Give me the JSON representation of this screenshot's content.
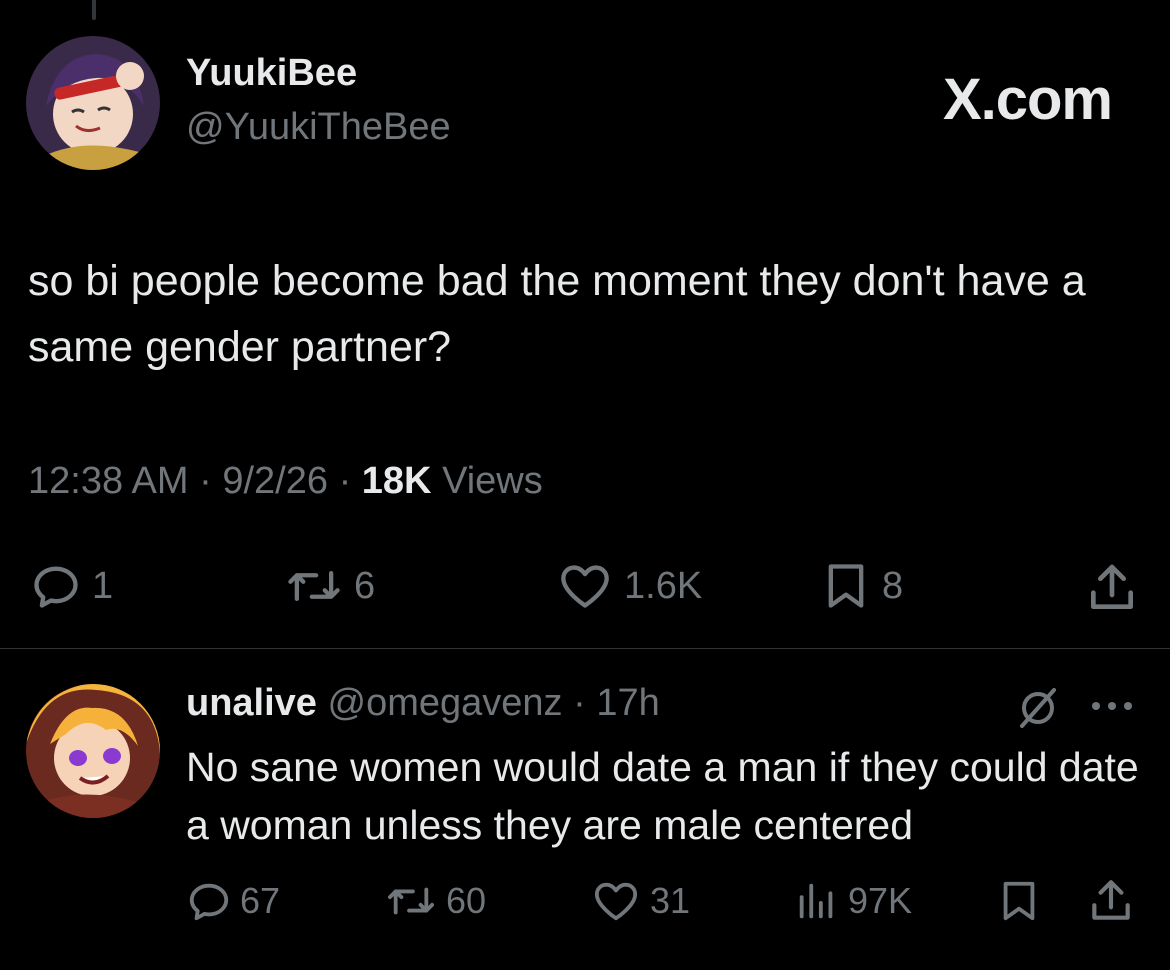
{
  "tweet": {
    "display_name": "YuukiBee",
    "handle": "@YuukiTheBee",
    "site_mark": "X.com",
    "text": "so bi people become bad the moment they don't have a same gender partner?",
    "time": "12:38 AM",
    "date": "9/2/26",
    "views_count": "18K",
    "views_label": "Views",
    "replies": "1",
    "reposts": "6",
    "likes": "1.6K",
    "bookmarks": "8"
  },
  "reply": {
    "display_name": "unalive",
    "handle": "@omegavenz",
    "time": "17h",
    "text": "No sane women would date a man if they could date a woman unless they are male centered",
    "replies": "67",
    "reposts": "60",
    "likes": "31",
    "views": "97K"
  },
  "icons": [
    "reply-icon",
    "repost-icon",
    "like-icon",
    "bookmark-icon",
    "share-icon",
    "views-icon",
    "grok-icon",
    "more-icon"
  ],
  "colors": {
    "background": "#000000",
    "text": "#e7e9ea",
    "muted": "#71767b",
    "divider": "#2f3336"
  }
}
